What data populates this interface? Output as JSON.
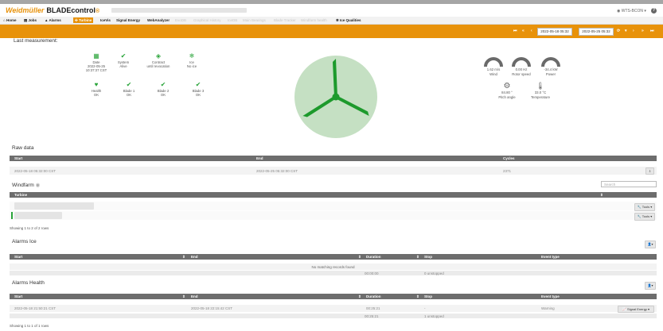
{
  "brand": {
    "name": "Weidmüller",
    "product": "BLADEcontrol",
    "tm": "®"
  },
  "user": {
    "name": "WTS-BCON"
  },
  "nav": [
    {
      "label": "Home",
      "icon": "home-icon",
      "active": false,
      "dim": false
    },
    {
      "label": "Jobs",
      "icon": "jobs-icon",
      "active": false,
      "dim": false
    },
    {
      "label": "Alarms",
      "icon": "alarm-icon",
      "active": false,
      "dim": false
    },
    {
      "label": "Turbine",
      "icon": "turbine-icon",
      "active": true,
      "dim": false
    },
    {
      "label": "IceVis",
      "icon": "",
      "active": false,
      "dim": false
    },
    {
      "label": "Signal Energy",
      "icon": "",
      "active": false,
      "dim": false
    },
    {
      "label": "WebAnalyzer",
      "icon": "",
      "active": false,
      "dim": false
    },
    {
      "label": "EvoDB",
      "icon": "",
      "active": false,
      "dim": true
    },
    {
      "label": "Graphical History",
      "icon": "",
      "active": false,
      "dim": true
    },
    {
      "label": "IceDB",
      "icon": "",
      "active": false,
      "dim": true
    },
    {
      "label": "Main Bearings",
      "icon": "",
      "active": false,
      "dim": true
    },
    {
      "label": "Blade Tracker",
      "icon": "",
      "active": false,
      "dim": true
    },
    {
      "label": "Windfarm health",
      "icon": "",
      "active": false,
      "dim": true
    },
    {
      "label": "Ice Qualities",
      "icon": "snowflake-icon",
      "active": false,
      "dim": false
    }
  ],
  "toolbar": {
    "first": "⏮",
    "prev_fast": "«",
    "prev": "‹",
    "date_from": "2022-05-18 05:32",
    "date_to": "2022-05-25 05:32",
    "refresh": "⟳",
    "next": "›",
    "next_fast": "»",
    "last": "⏭"
  },
  "last_measurement": {
    "title": "Last measurement:",
    "statuses": [
      {
        "label": "Date",
        "line1": "2022-05-25",
        "line2": "10:37:37 CST",
        "icon": "calendar-icon",
        "glyph": "▦"
      },
      {
        "label": "System",
        "line1": "Alive",
        "line2": "",
        "icon": "check-icon",
        "glyph": "✔"
      },
      {
        "label": "Contract",
        "line1": "until revocation",
        "line2": "",
        "icon": "contract-icon",
        "glyph": "◈"
      },
      {
        "label": "Ice",
        "line1": "No ice",
        "line2": "",
        "icon": "snowflake-icon",
        "glyph": "❄"
      },
      {
        "label": "Health",
        "line1": "OK",
        "line2": "",
        "icon": "heart-icon",
        "glyph": "♥"
      },
      {
        "label": "Blade 1",
        "line1": "OK",
        "line2": "",
        "icon": "check-icon",
        "glyph": "✔"
      },
      {
        "label": "Blade 2",
        "line1": "OK",
        "line2": "",
        "icon": "check-icon",
        "glyph": "✔"
      },
      {
        "label": "Blade 3",
        "line1": "OK",
        "line2": "",
        "icon": "check-icon",
        "glyph": "✔"
      }
    ],
    "gauges": [
      {
        "value": "1.62 m/s",
        "label": "Wind",
        "fraction": 0.1
      },
      {
        "value": "0.00 Hz",
        "label": "Rotor speed",
        "fraction": 0.0
      },
      {
        "value": "-34.4 kW",
        "label": "Power",
        "fraction": 0.0
      }
    ],
    "sensors": [
      {
        "value": "84.80 °",
        "label": "Pitch angle",
        "icon": "gears-icon",
        "glyph": "⚙"
      },
      {
        "value": "33.0 °C",
        "label": "Temperature",
        "icon": "thermometer-icon",
        "glyph": "🌡"
      }
    ]
  },
  "raw_data": {
    "title": "Raw data",
    "headers": [
      "Start",
      "End",
      "Cycles"
    ],
    "row": [
      "2022-05-18 05:32:00 CST",
      "2022-05-25 05:32:00 CST",
      "2371"
    ]
  },
  "windfarm": {
    "title": "Windfarm",
    "search_placeholder": "Search",
    "header": "Turbine",
    "tools_label": "Tools",
    "footer": "Showing 1 to 2 of 2 rows"
  },
  "alarms_ice": {
    "title": "Alarms Ice",
    "headers": [
      "Start",
      "End",
      "Duration",
      "Stop",
      "Event type"
    ],
    "empty": "No matching records found",
    "sum_duration": "00:00:00",
    "sum_stop": "0 unstopped"
  },
  "alarms_health": {
    "title": "Alarms Health",
    "headers": [
      "Start",
      "End",
      "Duration",
      "Stop",
      "Event type"
    ],
    "row": [
      "2022-05-18 21:50:21 CST",
      "2022-05-18 22:15:42 CST",
      "00:25:21",
      "-",
      "Warning"
    ],
    "row_button": "Signal Energy",
    "sum_duration": "00:25:21",
    "sum_stop": "1 unstopped",
    "footer": "Showing 1 to 1 of 1 rows"
  },
  "colors": {
    "accent": "#e8920a",
    "ok": "#2aa43a",
    "turbine_bg": "#c5e0c3",
    "turbine": "#1d9a2c",
    "header_gray": "#6d6d6d"
  }
}
